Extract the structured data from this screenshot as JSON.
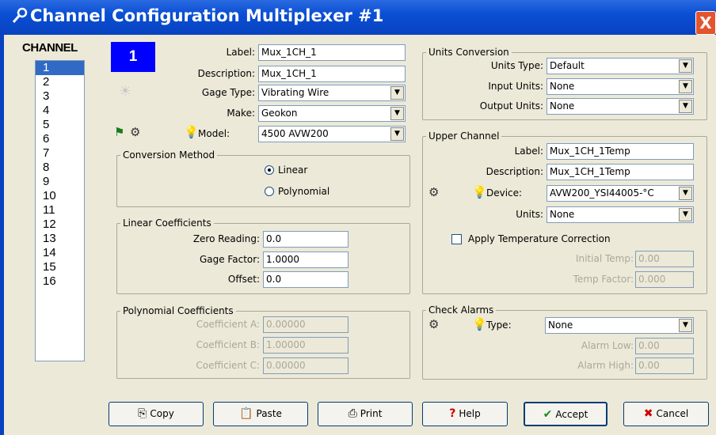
{
  "window": {
    "title": "Channel Configuration Multiplexer #1",
    "close": "X"
  },
  "channels": {
    "heading": "CHANNEL",
    "items": [
      "1",
      "2",
      "3",
      "4",
      "5",
      "6",
      "7",
      "8",
      "9",
      "10",
      "11",
      "12",
      "13",
      "14",
      "15",
      "16"
    ],
    "selected": "1",
    "current_number": "1"
  },
  "sensor": {
    "label_label": "Label:",
    "label_value": "Mux_1CH_1",
    "description_label": "Description:",
    "description_value": "Mux_1CH_1",
    "gage_type_label": "Gage Type:",
    "gage_type_value": "Vibrating Wire",
    "make_label": "Make:",
    "make_value": "Geokon",
    "model_label": "Model:",
    "model_value": "4500 AVW200"
  },
  "conversion_method": {
    "title": "Conversion Method",
    "linear": "Linear",
    "polynomial": "Polynomial",
    "selected": "Linear"
  },
  "linear_coefficients": {
    "title": "Linear Coefficients",
    "zero_reading_label": "Zero Reading:",
    "zero_reading_value": "0.0",
    "gage_factor_label": "Gage Factor:",
    "gage_factor_value": "1.0000",
    "offset_label": "Offset:",
    "offset_value": "0.0"
  },
  "polynomial_coefficients": {
    "title": "Polynomial Coefficients",
    "a_label": "Coefficient A:",
    "a_value": "0.00000",
    "b_label": "Coefficient B:",
    "b_value": "1.00000",
    "c_label": "Coefficient C:",
    "c_value": "0.00000"
  },
  "units_conversion": {
    "title": "Units Conversion",
    "units_type_label": "Units Type:",
    "units_type_value": "Default",
    "input_units_label": "Input Units:",
    "input_units_value": "None",
    "output_units_label": "Output Units:",
    "output_units_value": "None"
  },
  "upper_channel": {
    "title": "Upper Channel",
    "label_label": "Label:",
    "label_value": "Mux_1CH_1Temp",
    "description_label": "Description:",
    "description_value": "Mux_1CH_1Temp",
    "device_label": "Device:",
    "device_value": "AVW200_YSI44005-°C",
    "units_label": "Units:",
    "units_value": "None",
    "apply_temp_label": "Apply Temperature Correction",
    "initial_temp_label": "Initial Temp:",
    "initial_temp_value": "0.00",
    "temp_factor_label": "Temp Factor:",
    "temp_factor_value": "0.000"
  },
  "check_alarms": {
    "title": "Check Alarms",
    "type_label": "Type:",
    "type_value": "None",
    "alarm_low_label": "Alarm Low:",
    "alarm_low_value": "0.00",
    "alarm_high_label": "Alarm High:",
    "alarm_high_value": "0.00"
  },
  "buttons": {
    "copy": "Copy",
    "paste": "Paste",
    "print": "Print",
    "help": "Help",
    "accept": "Accept",
    "cancel": "Cancel"
  },
  "colors": {
    "title_bar": "#0a4fd4",
    "channel_badge": "#0000ff",
    "selection": "#316ac5",
    "close": "#e3552e"
  }
}
